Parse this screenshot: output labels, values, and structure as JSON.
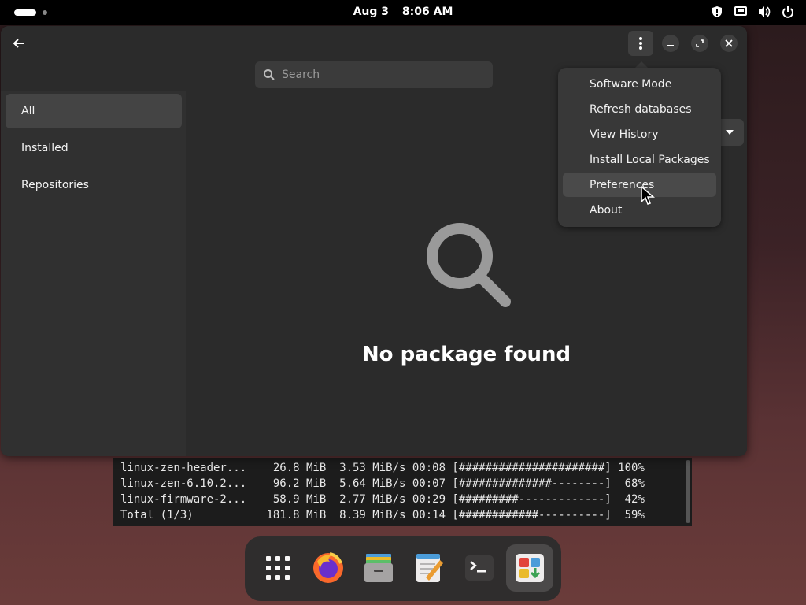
{
  "topbar": {
    "date": "Aug 3",
    "time": "8:06 AM",
    "tray_icons": [
      "shield-icon",
      "network-icon",
      "volume-icon",
      "power-icon"
    ]
  },
  "terminal": {
    "rows": [
      "linux-zen-header...    26.8 MiB  3.53 MiB/s 00:08 [######################] 100%",
      "linux-zen-6.10.2...    96.2 MiB  5.64 MiB/s 00:07 [##############--------]  68%",
      "linux-firmware-2...    58.9 MiB  2.77 MiB/s 00:29 [#########-------------]  42%",
      "Total (1/3)           181.8 MiB  8.39 MiB/s 00:14 [############----------]  59%"
    ]
  },
  "app": {
    "search_placeholder": "Search",
    "sidebar": [
      {
        "label": "All",
        "active": true
      },
      {
        "label": "Installed",
        "active": false
      },
      {
        "label": "Repositories",
        "active": false
      }
    ],
    "empty_message": "No package found",
    "menu": [
      {
        "label": "Software Mode"
      },
      {
        "label": "Refresh databases"
      },
      {
        "label": "View History"
      },
      {
        "label": "Install Local Packages"
      },
      {
        "label": "Preferences",
        "hover": true
      },
      {
        "label": "About"
      }
    ]
  },
  "dock": {
    "items": [
      "app-grid-icon",
      "firefox-icon",
      "files-icon",
      "text-editor-icon",
      "terminal-icon",
      "software-manager-icon"
    ],
    "running": "software-manager-icon"
  }
}
